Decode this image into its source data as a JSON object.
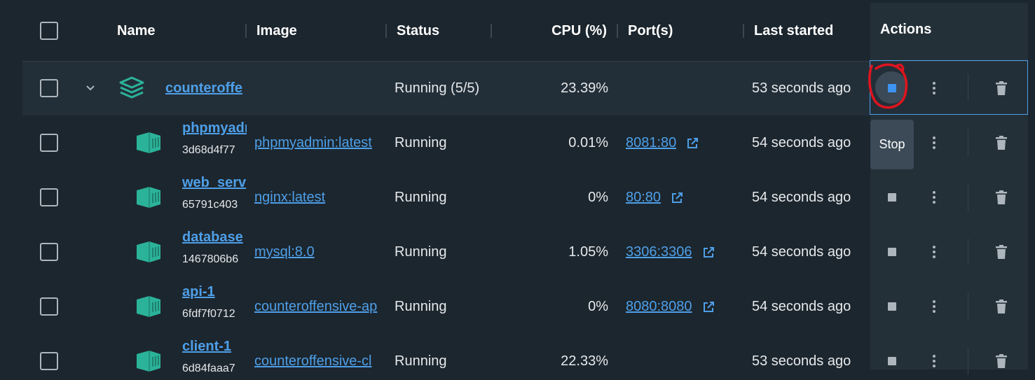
{
  "header": {
    "name": "Name",
    "image": "Image",
    "status": "Status",
    "cpu": "CPU (%)",
    "ports": "Port(s)",
    "last_started": "Last started",
    "actions": "Actions"
  },
  "group": {
    "name": "counteroffe",
    "status": "Running (5/5)",
    "cpu": "23.39%",
    "last_started": "53 seconds ago"
  },
  "rows": [
    {
      "name": "phpmyadm",
      "id": "3d68d4f77",
      "image": "phpmyadmin:latest",
      "status": "Running",
      "cpu": "0.01%",
      "port": "8081:80",
      "last_started": "54 seconds ago"
    },
    {
      "name": "web_serv",
      "id": "65791c403",
      "image": "nginx:latest",
      "status": "Running",
      "cpu": "0%",
      "port": "80:80",
      "last_started": "54 seconds ago"
    },
    {
      "name": "database",
      "id": "1467806b6",
      "image": "mysql:8.0",
      "status": "Running",
      "cpu": "1.05%",
      "port": "3306:3306",
      "last_started": "54 seconds ago"
    },
    {
      "name": "api-1",
      "id": "6fdf7f0712",
      "image": "counteroffensive-ap",
      "status": "Running",
      "cpu": "0%",
      "port": "8080:8080",
      "last_started": "54 seconds ago"
    },
    {
      "name": "client-1",
      "id": "6d84faaa7",
      "image": "counteroffensive-cl",
      "status": "Running",
      "cpu": "22.33%",
      "port": "",
      "last_started": "53 seconds ago"
    }
  ],
  "tooltip": {
    "label": "Stop"
  },
  "colors": {
    "accent": "#4e9fe8",
    "icon_teal": "#2bb39a",
    "annotation_red": "#e0141e"
  }
}
